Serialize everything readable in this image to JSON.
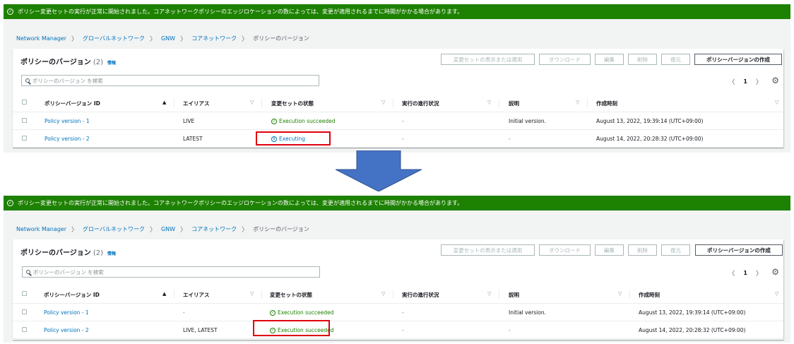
{
  "banner": {
    "message": "ポリシー変更セットの実行が正常に開始されました。コアネットワークポリシーのエッジロケーションの数によっては、変更が適用されるまでに時間がかかる場合があります。"
  },
  "breadcrumb": {
    "items": [
      "Network Manager",
      "グローバルネットワーク",
      "GNW",
      "コアネットワーク"
    ],
    "current": "ポリシーのバージョン",
    "separator": ">"
  },
  "card": {
    "title": "ポリシーのバージョン",
    "count": "(2)",
    "info": "情報"
  },
  "actions": {
    "view_apply": "変更セットの表示または適用",
    "download": "ダウンロード",
    "edit": "編集",
    "delete": "削除",
    "restore": "復元",
    "create": "ポリシーバージョンの作成"
  },
  "search": {
    "placeholder": "ポリシーのバージョン を検索"
  },
  "pagination": {
    "prev": "〈",
    "page": "1",
    "next": "〉"
  },
  "columns": [
    "ポリシーバージョン ID",
    "エイリアス",
    "変更セットの状態",
    "実行の進行状況",
    "説明",
    "作成時刻"
  ],
  "before": {
    "rows": [
      {
        "id": "Policy version - 1",
        "alias": "LIVE",
        "status": "Execution succeeded",
        "progress": "-",
        "description": "Initial version.",
        "created": "August 13, 2022, 19:39:14 (UTC+09:00)"
      },
      {
        "id": "Policy version - 2",
        "alias": "LATEST",
        "status": "Executing",
        "progress": "-",
        "description": "-",
        "created": "August 14, 2022, 20:28:32 (UTC+09:00)"
      }
    ]
  },
  "after": {
    "rows": [
      {
        "id": "Policy version - 1",
        "alias": "-",
        "status": "Execution succeeded",
        "progress": "-",
        "description": "Initial version.",
        "created": "August 13, 2022, 19:39:14 (UTC+09:00)"
      },
      {
        "id": "Policy version - 2",
        "alias": "LIVE, LATEST",
        "status": "Execution succeeded",
        "progress": "-",
        "description": "-",
        "created": "August 14, 2022, 20:28:32 (UTC+09:00)"
      }
    ]
  },
  "colors": {
    "banner": "#1d8102",
    "link": "#0073bb",
    "success": "#1d8102",
    "highlight": "#e0000f",
    "arrow": "#4472c4"
  },
  "icons": [
    "check-circle-icon",
    "info-icon",
    "search-icon",
    "gear-icon",
    "sort-icon",
    "arrow-down-icon"
  ]
}
